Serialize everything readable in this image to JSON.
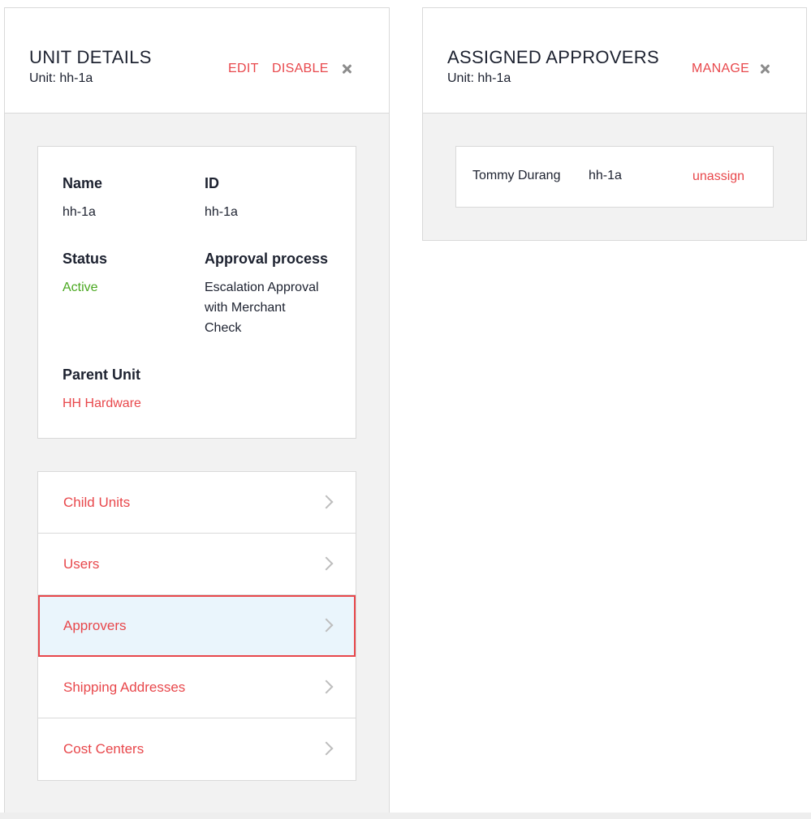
{
  "unit_details": {
    "title": "UNIT DETAILS",
    "subtitle": "Unit: hh-1a",
    "actions": {
      "edit": "EDIT",
      "disable": "DISABLE"
    },
    "fields": {
      "name_label": "Name",
      "name_value": "hh-1a",
      "id_label": "ID",
      "id_value": "hh-1a",
      "status_label": "Status",
      "status_value": "Active",
      "approval_label": "Approval process",
      "approval_value_lines": [
        "Escalation Approval",
        "with Merchant",
        "Check"
      ],
      "parent_label": "Parent Unit",
      "parent_value": "HH Hardware"
    },
    "nav_items": [
      {
        "label": "Child Units",
        "selected": false
      },
      {
        "label": "Users",
        "selected": false
      },
      {
        "label": "Approvers",
        "selected": true
      },
      {
        "label": "Shipping Addresses",
        "selected": false
      },
      {
        "label": "Cost Centers",
        "selected": false
      }
    ]
  },
  "assigned_approvers": {
    "title": "ASSIGNED APPROVERS",
    "subtitle": "Unit: hh-1a",
    "actions": {
      "manage": "MANAGE"
    },
    "rows": [
      {
        "name": "Tommy Durang",
        "unit": "hh-1a",
        "action": "unassign"
      }
    ]
  },
  "colors": {
    "accent": "#e8474b",
    "active": "#4aa820",
    "selected_bg": "#eaf5fc",
    "panel_bg": "#f2f2f2",
    "border": "#d9d9d9"
  }
}
